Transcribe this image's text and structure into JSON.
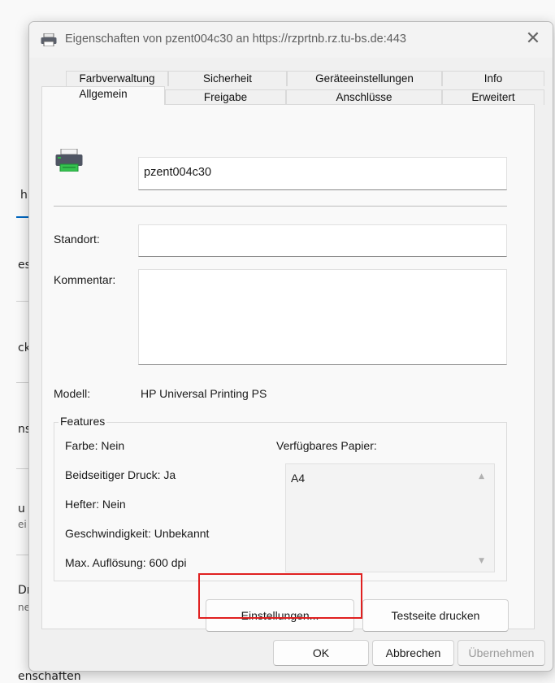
{
  "background": {
    "fragments": [
      "h",
      "es",
      "ck",
      "ns",
      "u",
      "ei",
      "Dr",
      "ne",
      "enschaften"
    ]
  },
  "dialog": {
    "title": "Eigenschaften von pzent004c30 an https://rzprtnb.rz.tu-bs.de:443",
    "close_glyph": "✕",
    "tabs_top": [
      "Farbverwaltung",
      "Sicherheit",
      "Geräteeinstellungen",
      "Info"
    ],
    "tabs_bottom": [
      "Allgemein",
      "Freigabe",
      "Anschlüsse",
      "Erweitert"
    ],
    "active_tab": "Allgemein",
    "printer_icon": "printer-icon",
    "printer_name": "pzent004c30",
    "location_label": "Standort:",
    "location_value": "",
    "comment_label": "Kommentar:",
    "comment_value": "",
    "model_label": "Modell:",
    "model_value": "HP Universal Printing PS",
    "features": {
      "title": "Features",
      "color": "Farbe: Nein",
      "duplex": "Beidseitiger Druck: Ja",
      "stapler": "Hefter: Nein",
      "speed": "Geschwindigkeit: Unbekannt",
      "resolution": "Max. Auflösung: 600 dpi",
      "paper_label": "Verfügbares Papier:",
      "paper_items": [
        "A4"
      ]
    },
    "buttons": {
      "settings": "Einstellungen...",
      "test_page": "Testseite drucken",
      "ok": "OK",
      "cancel": "Abbrechen",
      "apply": "Übernehmen"
    },
    "highlight_color": "#e02020"
  }
}
